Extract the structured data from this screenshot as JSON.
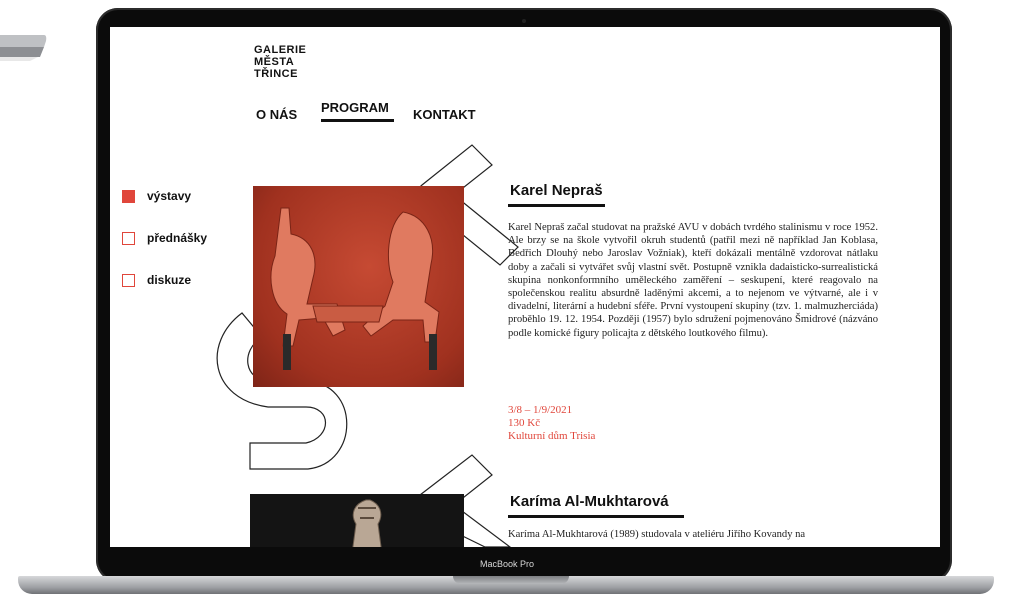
{
  "device": {
    "label": "MacBook Pro"
  },
  "site": {
    "logo": [
      "GALERIE",
      "MĚSTA",
      "TŘINCE"
    ],
    "nav": [
      {
        "label": "O NÁS"
      },
      {
        "label": "PROGRAM"
      },
      {
        "label": "KONTAKT"
      }
    ],
    "categories": [
      {
        "label": "výstavy",
        "selected": true
      },
      {
        "label": "přednášky",
        "selected": false
      },
      {
        "label": "diskuze",
        "selected": false
      }
    ],
    "accent_color": "#e0463b",
    "events": [
      {
        "title": "Karel Nepraš",
        "description": "Karel Nepraš začal studovat na pražské AVU v dobách tvrdého stalinismu v roce 1952. Ale brzy se na škole vytvořil okruh studentů (patřil mezi ně například Jan Koblasa, Bedřich Dlouhý nebo Jaroslav Vožniak), kteří dokázali mentálně vzdorovat nátlaku doby a začali si vytvářet svůj vlastní svět. Postupně vznikla dadaisticko-surrealistická skupina nonkonformního uměleckého zaměření – seskupení, které reagovalo na společenskou realitu absurdně laděnými akcemi, a to nejenom ve výtvarné, ale i v divadelní, literární a hudební sféře. První vystoupení skupiny (tzv. 1. malmuzherciáda) proběhlo 19. 12. 1954. Později (1957) bylo sdružení pojmenováno Šmidrové (názváno podle komické figury policajta z dětského loutkového filmu).",
        "date": "3/8 – 1/9/2021",
        "price": "130 Kč",
        "venue": "Kulturní dům Trisia"
      },
      {
        "title": "Karíma Al-Mukhtarová",
        "description": "Karíma Al-Mukhtarová (1989) studovala v ateliéru Jiřího Kovandy na"
      }
    ]
  }
}
